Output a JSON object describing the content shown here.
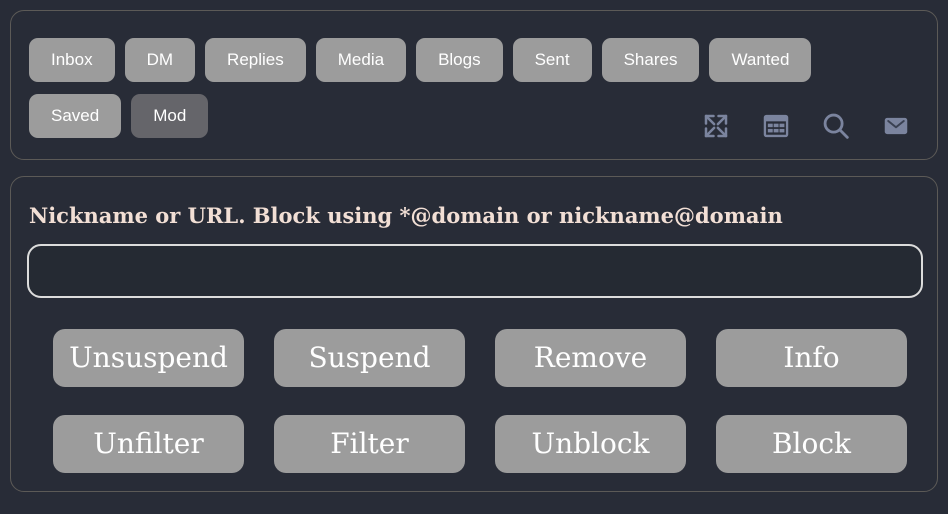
{
  "theme": {
    "background": "#282c37",
    "panel_border": "#5c5a57",
    "button_bg": "#9c9c9c",
    "button_active_bg": "#65656a",
    "button_text": "#ffffff",
    "heading_text": "#f2dfd5",
    "icon_color": "#7b849e",
    "input_border": "#dcdcdc",
    "input_bg": "#252a33"
  },
  "nav": {
    "tabs_row_1": [
      {
        "label": "Inbox",
        "active": false
      },
      {
        "label": "DM",
        "active": false
      },
      {
        "label": "Replies",
        "active": false
      },
      {
        "label": "Media",
        "active": false
      },
      {
        "label": "Blogs",
        "active": false
      },
      {
        "label": "Sent",
        "active": false
      },
      {
        "label": "Shares",
        "active": false
      },
      {
        "label": "Wanted",
        "active": false
      }
    ],
    "tabs_row_2": [
      {
        "label": "Saved",
        "active": false
      },
      {
        "label": "Mod",
        "active": true
      }
    ],
    "icons": [
      {
        "name": "expand-icon",
        "title": "Expand"
      },
      {
        "name": "table-icon",
        "title": "Table"
      },
      {
        "name": "search-icon",
        "title": "Search"
      },
      {
        "name": "mail-icon",
        "title": "Mail"
      }
    ]
  },
  "form": {
    "heading": "Nickname or URL. Block using *@domain or nickname@domain",
    "input": {
      "value": "",
      "placeholder": ""
    },
    "actions_row_1": [
      {
        "label": "Unsuspend"
      },
      {
        "label": "Suspend"
      },
      {
        "label": "Remove"
      },
      {
        "label": "Info"
      }
    ],
    "actions_row_2": [
      {
        "label": "Unfilter"
      },
      {
        "label": "Filter"
      },
      {
        "label": "Unblock"
      },
      {
        "label": "Block"
      }
    ]
  }
}
